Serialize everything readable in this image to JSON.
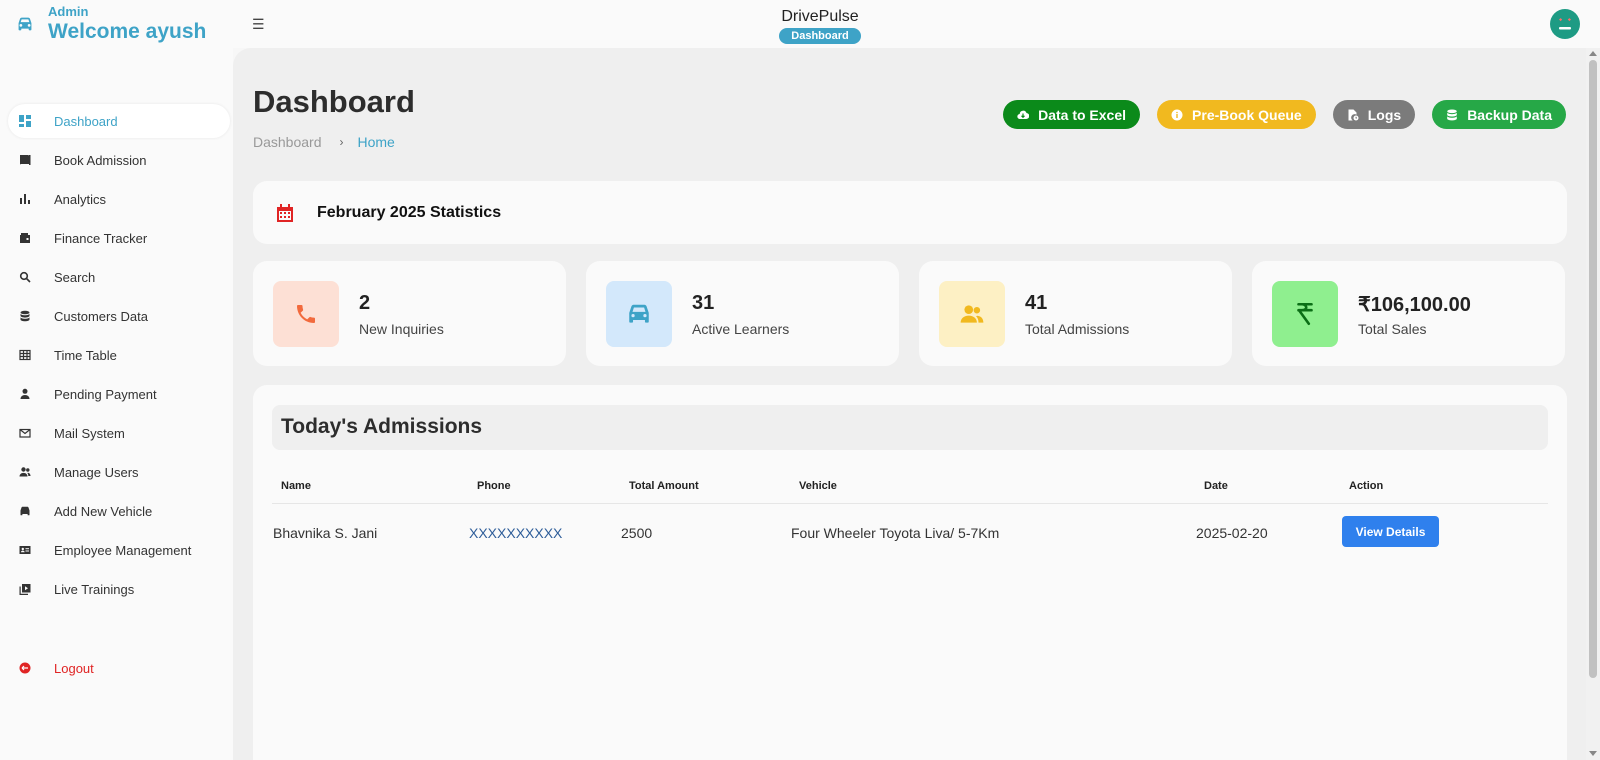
{
  "header": {
    "role": "Admin",
    "welcome": "Welcome ayush",
    "app_title": "DrivePulse",
    "app_badge": "Dashboard"
  },
  "sidebar": {
    "items": [
      {
        "label": "Dashboard",
        "icon": "dashboard-icon",
        "active": true
      },
      {
        "label": "Book Admission",
        "icon": "book-icon"
      },
      {
        "label": "Analytics",
        "icon": "bar-chart-icon"
      },
      {
        "label": "Finance Tracker",
        "icon": "wallet-icon"
      },
      {
        "label": "Search",
        "icon": "search-icon"
      },
      {
        "label": "Customers Data",
        "icon": "database-icon"
      },
      {
        "label": "Time Table",
        "icon": "table-icon"
      },
      {
        "label": "Pending Payment",
        "icon": "user-icon"
      },
      {
        "label": "Mail System",
        "icon": "mail-icon"
      },
      {
        "label": "Manage Users",
        "icon": "users-icon"
      },
      {
        "label": "Add New Vehicle",
        "icon": "car-icon"
      },
      {
        "label": "Employee Management",
        "icon": "id-card-icon"
      },
      {
        "label": "Live Trainings",
        "icon": "video-library-icon"
      }
    ],
    "logout": "Logout"
  },
  "page": {
    "title": "Dashboard",
    "breadcrumb": [
      "Dashboard",
      "Home"
    ]
  },
  "actions": {
    "excel": "Data to Excel",
    "queue": "Pre-Book Queue",
    "logs": "Logs",
    "backup": "Backup Data"
  },
  "stats": {
    "heading": "February 2025 Statistics",
    "cards": [
      {
        "value": "2",
        "label": "New Inquiries",
        "icon": "phone-icon",
        "bg": "#fde0d5",
        "color": "#f26a3d"
      },
      {
        "value": "31",
        "label": "Active Learners",
        "icon": "car-icon",
        "bg": "#d3e8fb",
        "color": "#3ea3c7"
      },
      {
        "value": "41",
        "label": "Total Admissions",
        "icon": "users-icon",
        "bg": "#fdf0c4",
        "color": "#f1b91f"
      },
      {
        "value": "₹106,100.00",
        "label": "Total Sales",
        "icon": "rupee-icon",
        "bg": "#8fef8f",
        "color": "#0b6e16"
      }
    ]
  },
  "admissions": {
    "title": "Today's Admissions",
    "columns": [
      "Name",
      "Phone",
      "Total Amount",
      "Vehicle",
      "Date",
      "Action"
    ],
    "rows": [
      {
        "name": "Bhavnika S. Jani",
        "phone": "XXXXXXXXXX",
        "amount": "2500",
        "vehicle": "Four Wheeler Toyota Liva/ 5-7Km",
        "date": "2025-02-20",
        "action": "View Details"
      }
    ]
  },
  "colors": {
    "accent": "#3ea3c7",
    "excel": "#0b8a1a",
    "queue": "#f1b91f",
    "logs": "#7b7b7b",
    "backup": "#26a847",
    "logout": "#e02424",
    "view_button": "#2f80ed"
  }
}
